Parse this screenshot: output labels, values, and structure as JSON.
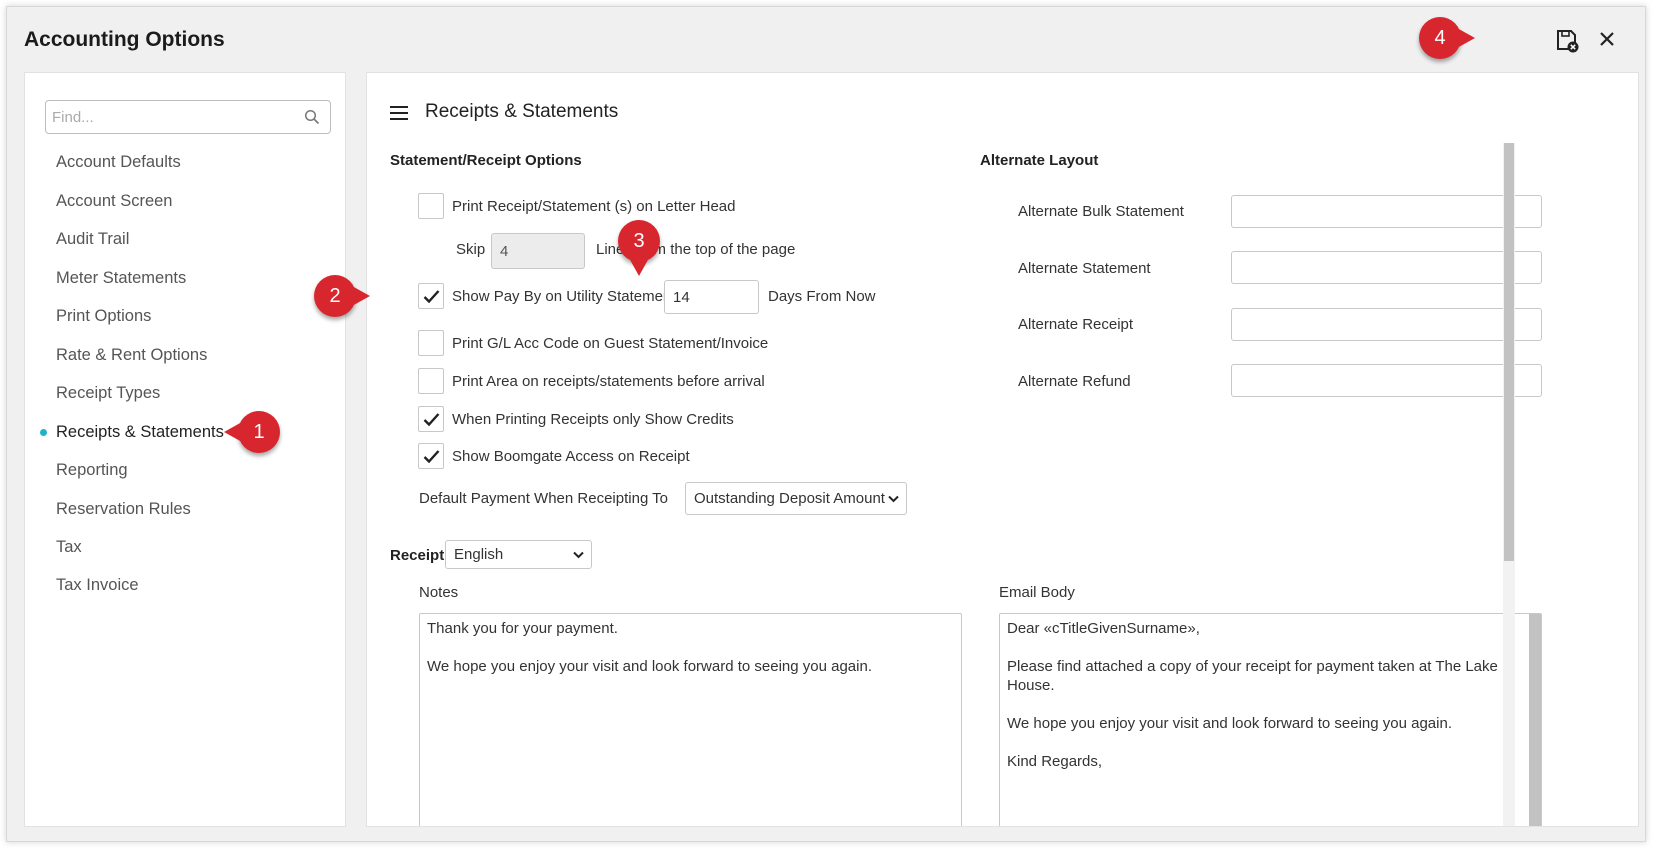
{
  "window": {
    "title": "Accounting Options"
  },
  "callouts": [
    "1",
    "2",
    "3",
    "4"
  ],
  "sidebar": {
    "search_placeholder": "Find...",
    "items": [
      {
        "label": "Account Defaults"
      },
      {
        "label": "Account Screen"
      },
      {
        "label": "Audit Trail"
      },
      {
        "label": "Meter Statements"
      },
      {
        "label": "Print Options"
      },
      {
        "label": "Rate & Rent Options"
      },
      {
        "label": "Receipt Types"
      },
      {
        "label": "Receipts & Statements",
        "active": true
      },
      {
        "label": "Reporting"
      },
      {
        "label": "Reservation Rules"
      },
      {
        "label": "Tax"
      },
      {
        "label": "Tax Invoice"
      }
    ]
  },
  "main": {
    "title": "Receipts & Statements",
    "statement_options": {
      "heading": "Statement/Receipt Options",
      "letter_head": {
        "label": "Print Receipt/Statement (s) on Letter Head",
        "checked": false
      },
      "skip": {
        "prefix": "Skip",
        "value": "4",
        "suffix": "Lines from the top of the page"
      },
      "pay_by": {
        "label": "Show Pay By on Utility Statement",
        "checked": true,
        "days_value": "14",
        "days_suffix": "Days From Now"
      },
      "gl_code": {
        "label": "Print G/L Acc Code on Guest Statement/Invoice",
        "checked": false
      },
      "print_area": {
        "label": "Print Area on receipts/statements before arrival",
        "checked": false
      },
      "only_credits": {
        "label": "When Printing Receipts only Show Credits",
        "checked": true
      },
      "boomgate": {
        "label": "Show Boomgate Access on Receipt",
        "checked": true
      },
      "default_payment": {
        "label": "Default Payment When Receipting To",
        "value": "Outstanding Deposit Amount"
      }
    },
    "alternate_layout": {
      "heading": "Alternate Layout",
      "fields": [
        {
          "label": "Alternate Bulk Statement",
          "value": ""
        },
        {
          "label": "Alternate Statement",
          "value": ""
        },
        {
          "label": "Alternate Receipt",
          "value": ""
        },
        {
          "label": "Alternate Refund",
          "value": ""
        }
      ]
    },
    "receipt": {
      "label": "Receipt",
      "language": "English",
      "notes_label": "Notes",
      "notes": [
        "Thank you for your payment.",
        "We hope you enjoy your visit and look forward to seeing you again."
      ],
      "email_label": "Email Body",
      "email": [
        "Dear «cTitleGivenSurname»,",
        "Please find attached a copy of your receipt for payment taken at The Lake House.",
        "We hope you enjoy your visit and look forward to seeing you again.",
        "Kind Regards,"
      ]
    }
  },
  "colors": {
    "callout": "#d8262f",
    "active_dot": "#1fb3c8"
  }
}
